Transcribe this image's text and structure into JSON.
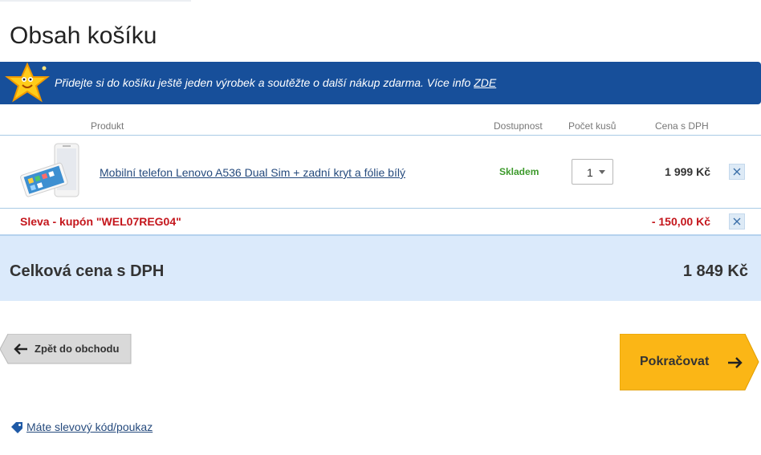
{
  "page": {
    "title": "Obsah košíku"
  },
  "promo": {
    "text": "Přidejte si do košíku ještě jeden výrobek a soutěžte o další nákup zdarma. Více info",
    "link": "ZDE"
  },
  "table": {
    "headers": {
      "product": "Produkt",
      "availability": "Dostupnost",
      "quantity": "Počet kusů",
      "price": "Cena s DPH"
    },
    "items": [
      {
        "name": "Mobilní telefon Lenovo A536 Dual Sim + zadní kryt a fólie bílý",
        "availability": "Skladem",
        "quantity": "1",
        "price": "1 999 Kč"
      }
    ],
    "discount": {
      "label": "Sleva - kupón \"WEL07REG04\"",
      "value": "- 150,00 Kč"
    }
  },
  "total": {
    "label": "Celková cena s DPH",
    "value": "1 849 Kč"
  },
  "buttons": {
    "back": "Zpět do obchodu",
    "continue": "Pokračovat"
  },
  "coupon_link": "Máte slevový kód/poukaz",
  "colors": {
    "promo_bg": "#174f9a",
    "total_bg": "#dbeafb",
    "continue_bg": "#fbb616",
    "discount_red": "#c4161c",
    "in_stock_green": "#3d9a2c",
    "link_blue": "#254a7d"
  },
  "icons": {
    "promo": "star-mascot-icon",
    "remove": "close-icon",
    "back": "arrow-left-icon",
    "continue": "arrow-right-icon",
    "coupon": "tag-icon",
    "quantity": "chevron-down-icon"
  }
}
